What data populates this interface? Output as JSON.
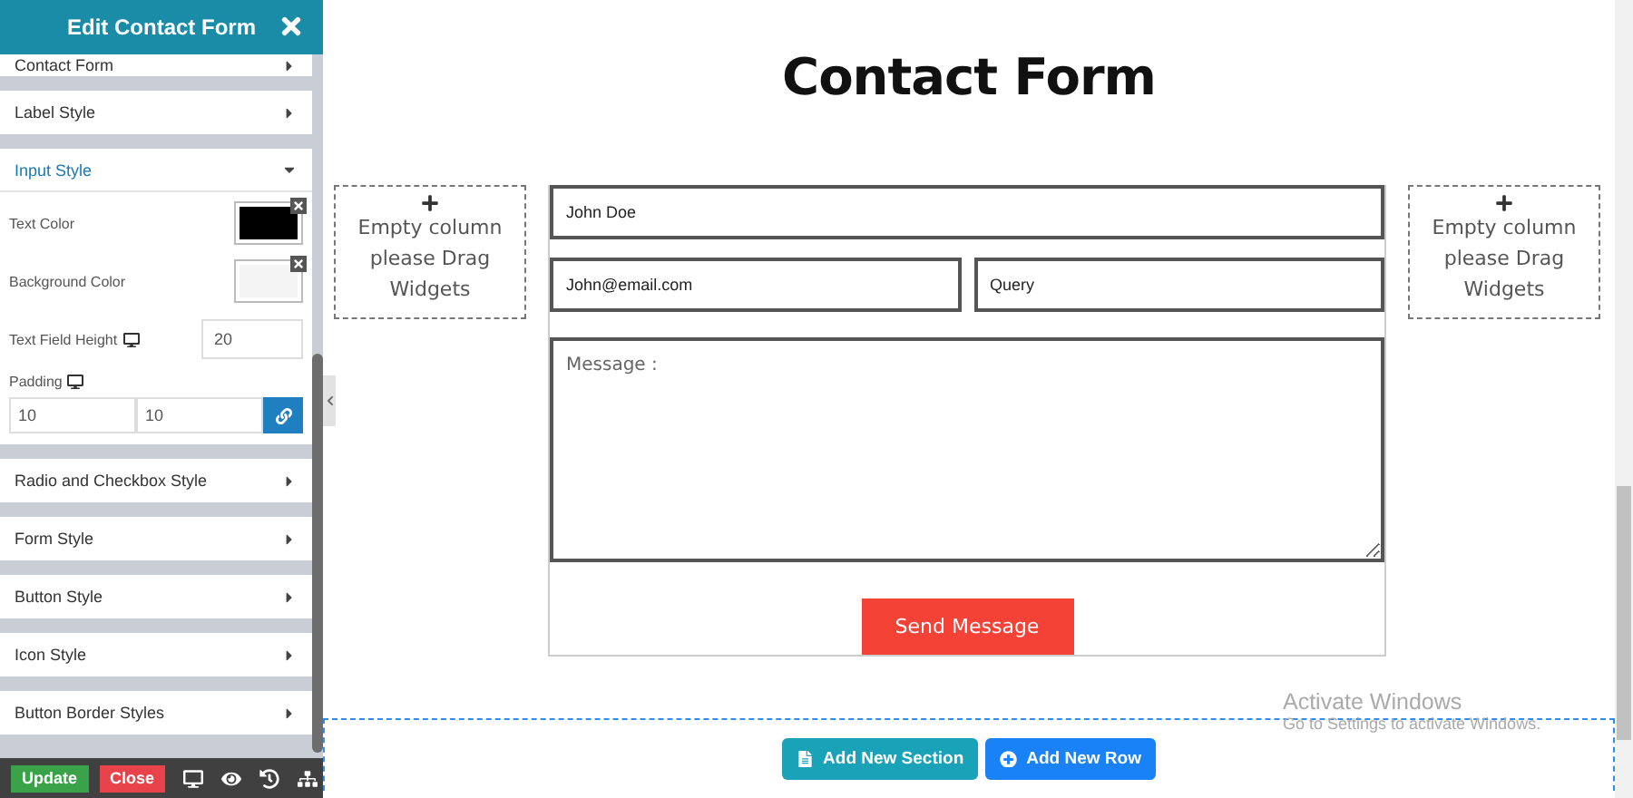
{
  "sidebar": {
    "title": "Edit Contact Form",
    "sections": [
      {
        "label": "Contact Form",
        "expanded": false
      },
      {
        "label": "Label Style",
        "expanded": false
      },
      {
        "label": "Input Style",
        "expanded": true,
        "fields": [
          {
            "kind": "color",
            "label": "Text Color",
            "color": "#000000"
          },
          {
            "kind": "color",
            "label": "Background Color",
            "color": "#f4f4f4"
          },
          {
            "kind": "number",
            "label": "Text Field Height",
            "responsive": true,
            "value": "20"
          },
          {
            "kind": "padding",
            "label": "Padding",
            "responsive": true,
            "values": [
              "10",
              "10"
            ],
            "linked": true
          }
        ]
      },
      {
        "label": "Radio and Checkbox Style",
        "expanded": false
      },
      {
        "label": "Form Style",
        "expanded": false
      },
      {
        "label": "Button Style",
        "expanded": false
      },
      {
        "label": "Icon Style",
        "expanded": false
      },
      {
        "label": "Button Border Styles",
        "expanded": false
      }
    ],
    "footer": {
      "buttons": [
        {
          "label": "Update",
          "kind": "primary"
        },
        {
          "label": "Close",
          "kind": "danger"
        }
      ]
    }
  },
  "canvas": {
    "title": "Contact Form",
    "empty_columns": [
      {
        "text": "Empty column please Drag Widgets"
      },
      {
        "text": "Empty column please Drag Widgets"
      }
    ],
    "form": {
      "name": {
        "placeholder": "John Doe"
      },
      "email": {
        "placeholder": "John@email.com"
      },
      "subject": {
        "placeholder": "Query"
      },
      "message": {
        "placeholder": "Message :"
      },
      "submit": "Send Message"
    },
    "add_buttons": [
      {
        "label": "Add New Section",
        "kind": "section"
      },
      {
        "label": "Add New Row",
        "kind": "row"
      }
    ]
  },
  "os_notice": {
    "title": "Activate Windows",
    "subtitle": "Go to Settings to activate Windows."
  }
}
